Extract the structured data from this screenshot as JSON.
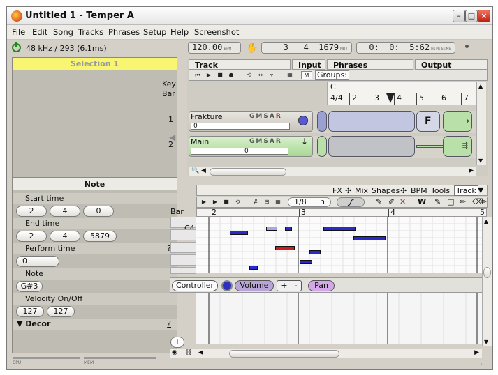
{
  "window": {
    "title": "Untitled 1 - Temper A"
  },
  "menu": [
    "File",
    "Edit",
    "Song",
    "Tracks",
    "Phrases",
    "Setup",
    "Help",
    "Screenshot"
  ],
  "status": {
    "sample_rate": "48 kHz / 293 (6.1ms)",
    "tempo_value": "120.00",
    "tempo_unit": "BPM",
    "position_mbt": "3   4  1679",
    "position_mbt_unit": "MBT",
    "position_time": "0:  0:  5:62",
    "position_time_unit": "H:M:S:MS"
  },
  "selection": {
    "title": "Selection 1"
  },
  "note_panel": {
    "title": "Note",
    "start_time": {
      "label": "Start time",
      "values": [
        "2",
        "4",
        "0"
      ]
    },
    "end_time": {
      "label": "End time",
      "values": [
        "2",
        "4",
        "5879"
      ]
    },
    "perform_time": {
      "label": "Perform time",
      "help": "?",
      "value": "0"
    },
    "note": {
      "label": "Note",
      "value": "G#3"
    },
    "velocity": {
      "label": "Velocity On/Off",
      "values": [
        "127",
        "127"
      ]
    },
    "decor": {
      "label": "Decor",
      "help": "?"
    }
  },
  "track_header": {
    "track": "Track",
    "input": "Input",
    "phrases": "Phrases",
    "output": "Output"
  },
  "track_toolbar": {
    "m_button": "M",
    "groups_label": "Groups:"
  },
  "ruler_top": {
    "key_label": "Key",
    "bar_label": "Bar",
    "key_value": "C",
    "time_sig": "4/4",
    "bars": [
      "2",
      "3",
      "4",
      "5",
      "6",
      "7"
    ]
  },
  "tracks": [
    {
      "number": "1",
      "name": "Frakture",
      "buttons": [
        "G",
        "M",
        "S",
        "A",
        "R"
      ],
      "value": "0"
    },
    {
      "number": "2",
      "name": "Main",
      "buttons": [
        "G",
        "M",
        "S",
        "A",
        "R"
      ],
      "value": "0"
    }
  ],
  "phrase_tabs": [
    "FX",
    "Mix",
    "Shapes",
    "BPM",
    "Tools",
    "Track"
  ],
  "phrase_toolbar": {
    "quantize": "1/8",
    "quantize_mode": "n"
  },
  "piano_roll": {
    "bar_label": "Bar",
    "bars": [
      "2",
      "3",
      "4",
      "5"
    ],
    "key_label": "C4"
  },
  "controller_bar": {
    "controller": "Controller",
    "volume": "Volume",
    "plus": "+",
    "minus": "-",
    "pan": "Pan"
  },
  "bottom_status": {
    "cpu": "CPU",
    "mem": "MEM"
  },
  "colors": {
    "selected_note": "#cc1c1c",
    "note": "#2a2ac8",
    "ghost_note": "#a8a8e0",
    "selection_bar": "#f7f572",
    "volume_pill": "#b9a4d8"
  }
}
